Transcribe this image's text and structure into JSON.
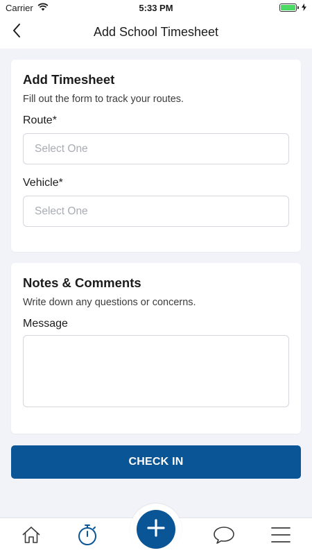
{
  "status_bar": {
    "carrier": "Carrier",
    "time": "5:33 PM"
  },
  "header": {
    "title": "Add School Timesheet",
    "back_icon": "chevron-left-icon"
  },
  "timesheet_card": {
    "title": "Add Timesheet",
    "subtitle": "Fill out the form to track your routes.",
    "route": {
      "label": "Route*",
      "placeholder": "Select One"
    },
    "vehicle": {
      "label": "Vehicle*",
      "placeholder": "Select One"
    }
  },
  "notes_card": {
    "title": "Notes & Comments",
    "subtitle": "Write down any questions or concerns.",
    "message": {
      "label": "Message",
      "value": ""
    }
  },
  "checkin_button": {
    "label": "CHECK IN"
  },
  "tab_bar": {
    "items": [
      {
        "icon": "home-icon"
      },
      {
        "icon": "stopwatch-icon",
        "active": true
      },
      {
        "icon": "plus-icon"
      },
      {
        "icon": "chat-bubble-icon"
      },
      {
        "icon": "menu-icon"
      }
    ]
  },
  "colors": {
    "primary": "#0a5596",
    "background": "#f2f3f8",
    "card": "#ffffff",
    "placeholder": "#a9acb3",
    "battery": "#4cd964"
  }
}
